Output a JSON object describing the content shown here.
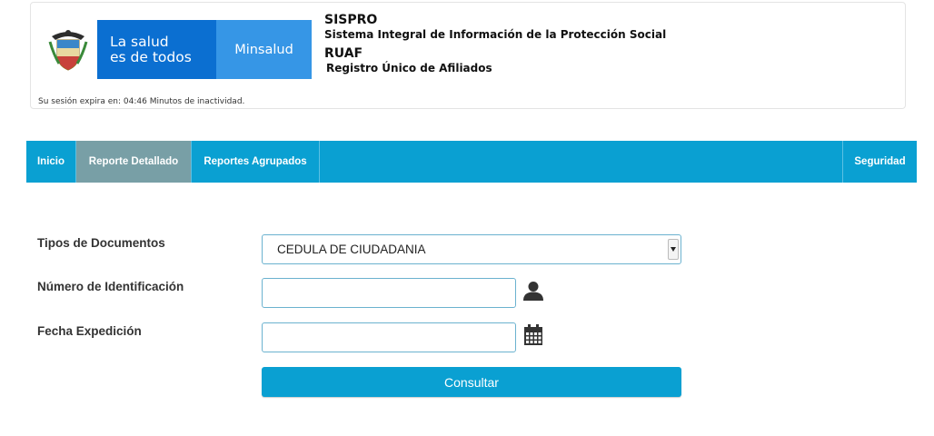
{
  "header": {
    "slogan_line1": "La salud",
    "slogan_line2": "es de todos",
    "brand": "Minsalud",
    "system_name": "SISPRO",
    "system_desc": "Sistema Integral de Información de la Protección Social",
    "module_name": "RUAF",
    "module_desc": "Registro Único de Afiliados",
    "session_text": "Su sesión expira en: 04:46 Minutos de inactividad.",
    "colors": {
      "slogan_bg": "#0b6fd1",
      "brand_bg": "#3696e6"
    }
  },
  "nav": {
    "items": [
      {
        "label": "Inicio",
        "active": false
      },
      {
        "label": "Reporte Detallado",
        "active": true
      },
      {
        "label": "Reportes Agrupados",
        "active": false
      }
    ],
    "right_item": "Seguridad",
    "colors": {
      "bar": "#0aa0d2",
      "active": "#789fa6"
    }
  },
  "form": {
    "doc_type_label": "Tipos de Documentos",
    "doc_type_value": "CEDULA DE CIUDADANIA",
    "id_number_label": "Número de Identificación",
    "id_number_value": "",
    "id_number_icon": "user-icon",
    "exp_date_label": "Fecha Expedición",
    "exp_date_value": "",
    "exp_date_icon": "calendar-icon",
    "submit_label": "Consultar"
  }
}
